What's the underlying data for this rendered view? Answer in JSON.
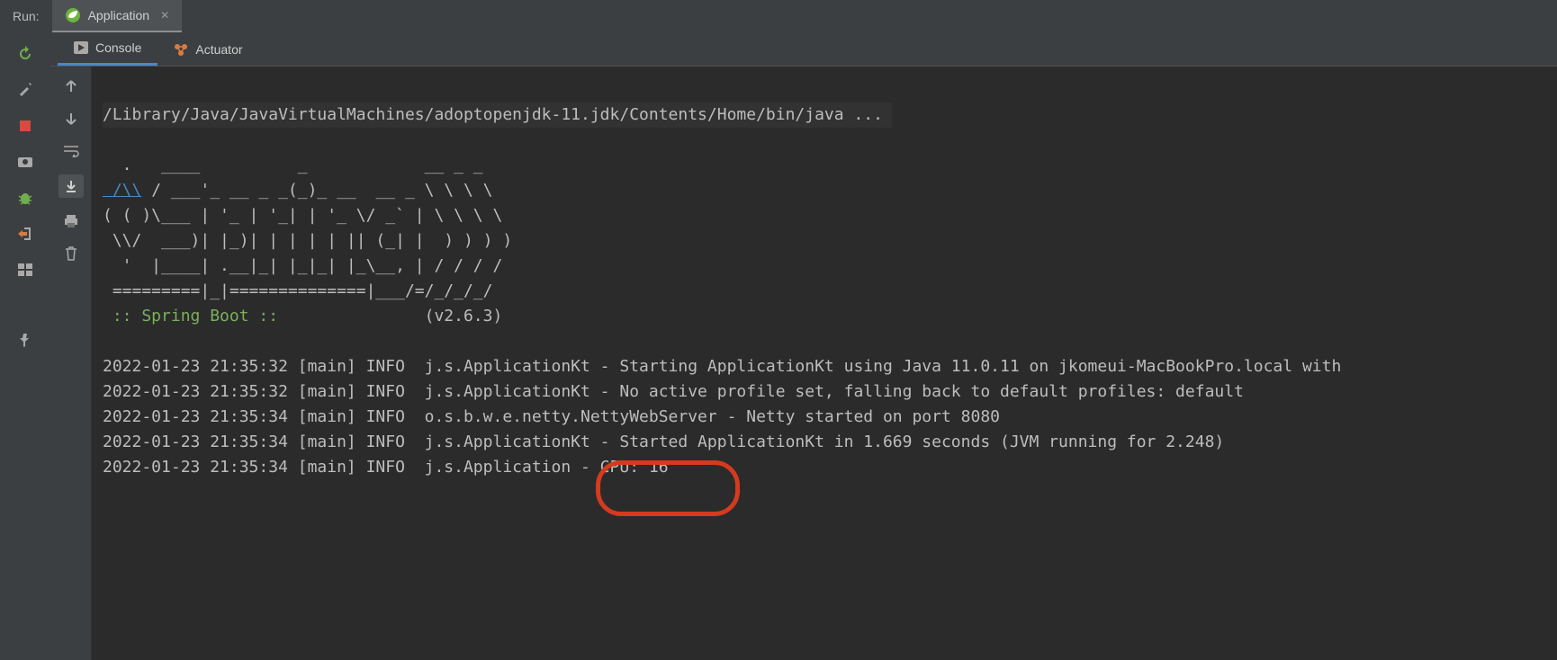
{
  "topbar": {
    "panel_label": "Run:",
    "tab_title": "Application"
  },
  "tabs": {
    "console": "Console",
    "actuator": "Actuator"
  },
  "console": {
    "command": "/Library/Java/JavaVirtualMachines/adoptopenjdk-11.jdk/Contents/Home/bin/java ...",
    "banner": {
      "line1": "  .   ____          _            __ _ _",
      "line2_link": " /\\\\",
      "line2_rest": " / ___'_ __ _ _(_)_ __  __ _ \\ \\ \\ \\",
      "line3": "( ( )\\___ | '_ | '_| | '_ \\/ _` | \\ \\ \\ \\",
      "line4": " \\\\/  ___)| |_)| | | | | || (_| |  ) ) ) )",
      "line5": "  '  |____| .__|_| |_|_| |_\\__, | / / / /",
      "line6": " =========|_|==============|___/=/_/_/_/"
    },
    "spring_label": " :: Spring Boot :: ",
    "spring_version": "              (v2.6.3)",
    "logs": [
      "2022-01-23 21:35:32 [main] INFO  j.s.ApplicationKt - Starting ApplicationKt using Java 11.0.11 on jkomeui-MacBookPro.local with",
      "2022-01-23 21:35:32 [main] INFO  j.s.ApplicationKt - No active profile set, falling back to default profiles: default",
      "2022-01-23 21:35:34 [main] INFO  o.s.b.w.e.netty.NettyWebServer - Netty started on port 8080",
      "2022-01-23 21:35:34 [main] INFO  j.s.ApplicationKt - Started ApplicationKt in 1.669 seconds (JVM running for 2.248)",
      "2022-01-23 21:35:34 [main] INFO  j.s.Application - CPU: 16"
    ]
  },
  "icons": {
    "rerun": "rerun-icon",
    "wrench": "wrench-icon",
    "stop": "stop-icon",
    "camera": "camera-icon",
    "bug": "bug-icon",
    "exit": "exit-icon",
    "layout": "layout-icon",
    "pin": "pin-icon",
    "up": "arrow-up-icon",
    "down": "arrow-down-icon",
    "wrap": "soft-wrap-icon",
    "scroll": "scroll-to-end-icon",
    "print": "print-icon",
    "trash": "trash-icon",
    "play": "play-icon",
    "actuator": "actuator-icon",
    "spring": "spring-leaf-icon"
  },
  "accent": "#4a88c7"
}
